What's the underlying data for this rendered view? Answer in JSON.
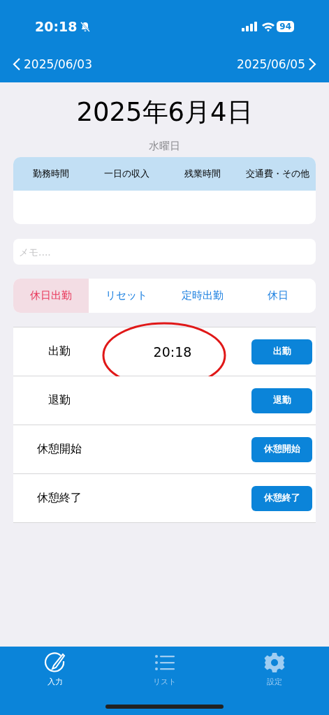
{
  "status_bar": {
    "time": "20:18",
    "battery": "94"
  },
  "nav": {
    "previous": "2025/06/03",
    "next": "2025/06/05"
  },
  "date": "2025年6月4日",
  "weekday": "水曜日",
  "summary": {
    "columns": [
      "勤務時間",
      "一日の収入",
      "残業時間",
      "交通費・その他"
    ]
  },
  "memo": {
    "placeholder": "メモ...."
  },
  "segments": [
    {
      "label": "休日出勤",
      "selected": true
    },
    {
      "label": "リセット",
      "selected": false
    },
    {
      "label": "定時出勤",
      "selected": false
    },
    {
      "label": "休日",
      "selected": false
    }
  ],
  "punches": [
    {
      "label": "出勤",
      "time": "20:18",
      "circled": true,
      "button": "出勤"
    },
    {
      "label": "退勤",
      "circled": false,
      "button": "退勤"
    },
    {
      "label": "休憩開始",
      "circled": false,
      "button": "休憩開始"
    },
    {
      "label": "休憩終了",
      "circled": false,
      "button": "休憩終了"
    }
  ],
  "tab_bar": [
    {
      "label": "入力",
      "kind": "input",
      "selected": true
    },
    {
      "label": "リスト",
      "kind": "list",
      "selected": false
    },
    {
      "label": "設定",
      "kind": "settings",
      "selected": false
    }
  ]
}
